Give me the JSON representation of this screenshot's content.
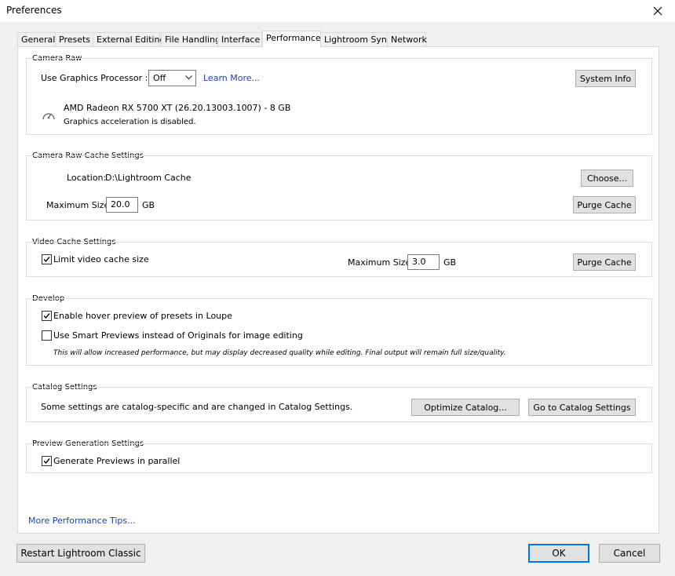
{
  "window": {
    "title": "Preferences"
  },
  "tabs": [
    {
      "label": "General"
    },
    {
      "label": "Presets"
    },
    {
      "label": "External Editing"
    },
    {
      "label": "File Handling"
    },
    {
      "label": "Interface"
    },
    {
      "label": "Performance"
    },
    {
      "label": "Lightroom Sync"
    },
    {
      "label": "Network"
    }
  ],
  "active_tab": "Performance",
  "camera_raw": {
    "title": "Camera Raw",
    "gpu_label": "Use Graphics Processor :",
    "gpu_value": "Off",
    "learn_more": "Learn More...",
    "system_info_button": "System Info",
    "gpu_name": "AMD Radeon RX 5700 XT (26.20.13003.1007) - 8 GB",
    "gpu_status": "Graphics acceleration is disabled."
  },
  "cache": {
    "title": "Camera Raw Cache Settings",
    "location_label": "Location:",
    "location_value": "D:\\Lightroom Cache",
    "choose_button": "Choose...",
    "max_size_label": "Maximum Size:",
    "max_size_value": "20.0",
    "unit": "GB",
    "purge_button": "Purge Cache"
  },
  "video_cache": {
    "title": "Video Cache Settings",
    "limit_label": "Limit video cache size",
    "limit_checked": true,
    "max_size_label": "Maximum Size:",
    "max_size_value": "3.0",
    "unit": "GB",
    "purge_button": "Purge Cache"
  },
  "develop": {
    "title": "Develop",
    "hover_label": "Enable hover preview of presets in Loupe",
    "hover_checked": true,
    "smart_label": "Use Smart Previews instead of Originals for image editing",
    "smart_checked": false,
    "note": "This will allow increased performance, but may display decreased quality while editing. Final output will remain full size/quality."
  },
  "catalog": {
    "title": "Catalog Settings",
    "description": "Some settings are catalog-specific and are changed in Catalog Settings.",
    "optimize_button": "Optimize Catalog...",
    "goto_button": "Go to Catalog Settings"
  },
  "preview": {
    "title": "Preview Generation Settings",
    "parallel_label": "Generate Previews in parallel",
    "parallel_checked": true
  },
  "footer": {
    "tips_link": "More Performance Tips...",
    "restart_button": "Restart Lightroom Classic",
    "ok_button": "OK",
    "cancel_button": "Cancel"
  },
  "colors": {
    "link": "#1a3fb5",
    "default_button_border": "#0078d7"
  },
  "icons": {
    "close": "close-icon",
    "dropdown": "chevron-down-icon",
    "gpu": "gauge-icon",
    "check": "checkmark-icon"
  }
}
